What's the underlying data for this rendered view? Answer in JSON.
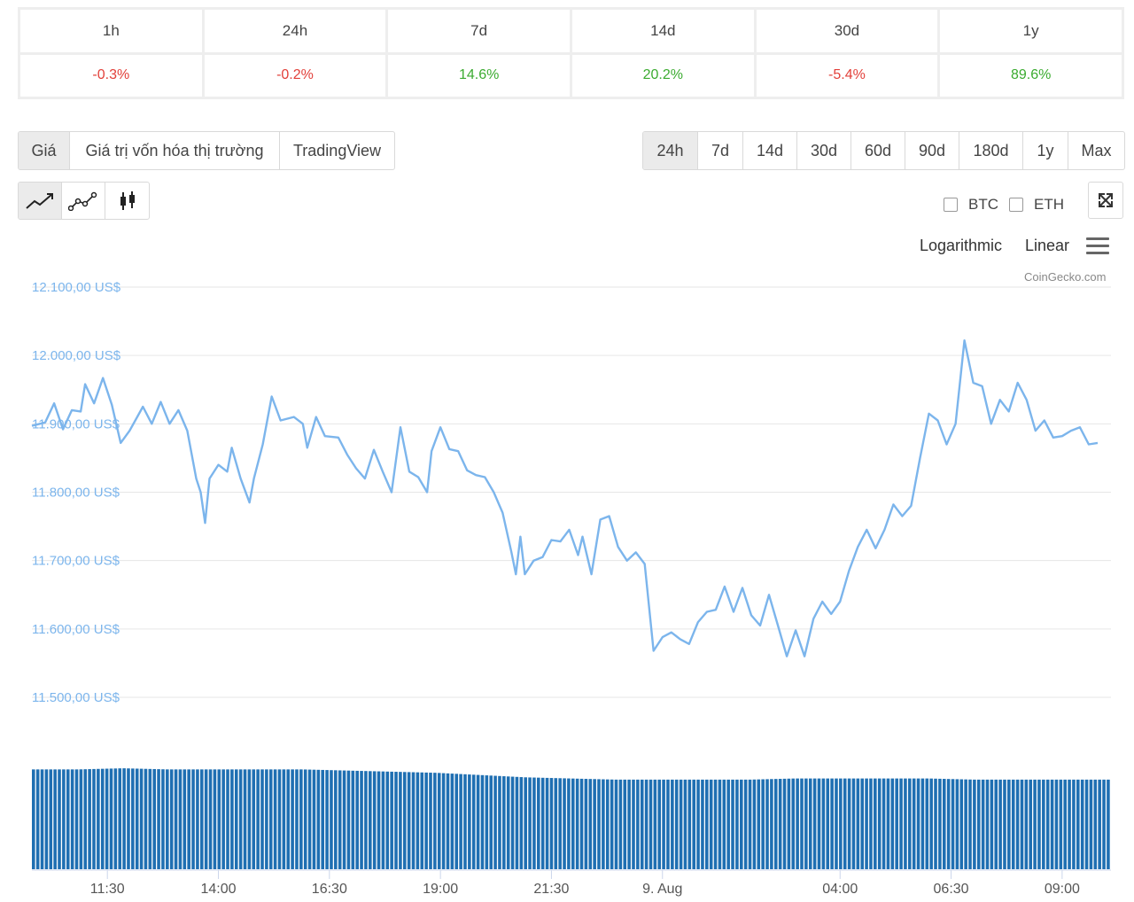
{
  "performance": {
    "periods": [
      "1h",
      "24h",
      "7d",
      "14d",
      "30d",
      "1y"
    ],
    "changes": [
      "-0.3%",
      "-0.2%",
      "14.6%",
      "20.2%",
      "-5.4%",
      "89.6%"
    ],
    "directions": [
      "neg",
      "neg",
      "pos",
      "pos",
      "neg",
      "pos"
    ]
  },
  "view_tabs": [
    "Giá",
    "Giá trị vốn hóa thị trường",
    "TradingView"
  ],
  "range_tabs": [
    "24h",
    "7d",
    "14d",
    "30d",
    "60d",
    "90d",
    "180d",
    "1y",
    "Max"
  ],
  "chart_type_icons": [
    "line-chart-icon",
    "scatter-line-icon",
    "candlestick-icon"
  ],
  "compare": {
    "btc": "BTC",
    "eth": "ETH"
  },
  "scale_options": {
    "log": "Logarithmic",
    "linear": "Linear"
  },
  "credits": "CoinGecko.com",
  "colors": {
    "line": "#7cb5ec",
    "volume": "#1f6fb2",
    "negative": "#e2403a",
    "positive": "#3bab30"
  },
  "chart_data": {
    "type": "line",
    "title": "",
    "ylabel": "",
    "xlabel": "",
    "ylim": [
      11500,
      12100
    ],
    "y_ticks": [
      "11.500,00 US$",
      "11.600,00 US$",
      "11.700,00 US$",
      "11.800,00 US$",
      "11.900,00 US$",
      "12.000,00 US$",
      "12.100,00 US$"
    ],
    "y_tick_values": [
      11500,
      11600,
      11700,
      11800,
      11900,
      12000,
      12100
    ],
    "x_ticks": [
      "11:30",
      "14:00",
      "16:30",
      "19:00",
      "21:30",
      "9. Aug",
      "04:00",
      "06:30",
      "09:00"
    ],
    "x_tick_hours": [
      11.5,
      14,
      16.5,
      19,
      21.5,
      24,
      28,
      30.5,
      33
    ],
    "x_range_hours": [
      9.8,
      34.1
    ],
    "series": [
      {
        "points": [
          [
            9.8,
            11897
          ],
          [
            10.1,
            11902
          ],
          [
            10.3,
            11930
          ],
          [
            10.5,
            11892
          ],
          [
            10.7,
            11920
          ],
          [
            10.9,
            11918
          ],
          [
            11.0,
            11958
          ],
          [
            11.2,
            11930
          ],
          [
            11.4,
            11967
          ],
          [
            11.6,
            11928
          ],
          [
            11.8,
            11872
          ],
          [
            12.0,
            11890
          ],
          [
            12.3,
            11925
          ],
          [
            12.5,
            11900
          ],
          [
            12.7,
            11932
          ],
          [
            12.9,
            11900
          ],
          [
            13.1,
            11920
          ],
          [
            13.3,
            11890
          ],
          [
            13.5,
            11820
          ],
          [
            13.6,
            11800
          ],
          [
            13.7,
            11755
          ],
          [
            13.8,
            11820
          ],
          [
            14.0,
            11840
          ],
          [
            14.2,
            11830
          ],
          [
            14.3,
            11865
          ],
          [
            14.5,
            11820
          ],
          [
            14.7,
            11785
          ],
          [
            14.8,
            11820
          ],
          [
            15.0,
            11870
          ],
          [
            15.2,
            11940
          ],
          [
            15.4,
            11905
          ],
          [
            15.7,
            11910
          ],
          [
            15.9,
            11900
          ],
          [
            16.0,
            11865
          ],
          [
            16.2,
            11910
          ],
          [
            16.4,
            11882
          ],
          [
            16.7,
            11880
          ],
          [
            16.9,
            11855
          ],
          [
            17.1,
            11835
          ],
          [
            17.3,
            11820
          ],
          [
            17.5,
            11862
          ],
          [
            17.7,
            11830
          ],
          [
            17.9,
            11800
          ],
          [
            18.1,
            11895
          ],
          [
            18.3,
            11830
          ],
          [
            18.5,
            11822
          ],
          [
            18.7,
            11800
          ],
          [
            18.8,
            11860
          ],
          [
            19.0,
            11895
          ],
          [
            19.2,
            11863
          ],
          [
            19.4,
            11860
          ],
          [
            19.6,
            11832
          ],
          [
            19.8,
            11825
          ],
          [
            20.0,
            11822
          ],
          [
            20.2,
            11800
          ],
          [
            20.4,
            11770
          ],
          [
            20.6,
            11712
          ],
          [
            20.7,
            11680
          ],
          [
            20.8,
            11735
          ],
          [
            20.9,
            11680
          ],
          [
            21.1,
            11700
          ],
          [
            21.3,
            11705
          ],
          [
            21.5,
            11730
          ],
          [
            21.7,
            11728
          ],
          [
            21.9,
            11745
          ],
          [
            22.1,
            11708
          ],
          [
            22.2,
            11735
          ],
          [
            22.4,
            11680
          ],
          [
            22.6,
            11760
          ],
          [
            22.8,
            11765
          ],
          [
            23.0,
            11720
          ],
          [
            23.2,
            11700
          ],
          [
            23.4,
            11712
          ],
          [
            23.6,
            11695
          ],
          [
            23.8,
            11568
          ],
          [
            24.0,
            11588
          ],
          [
            24.2,
            11595
          ],
          [
            24.4,
            11585
          ],
          [
            24.6,
            11578
          ],
          [
            24.8,
            11610
          ],
          [
            25.0,
            11625
          ],
          [
            25.2,
            11628
          ],
          [
            25.4,
            11662
          ],
          [
            25.6,
            11625
          ],
          [
            25.8,
            11660
          ],
          [
            26.0,
            11620
          ],
          [
            26.2,
            11605
          ],
          [
            26.4,
            11650
          ],
          [
            26.6,
            11605
          ],
          [
            26.8,
            11560
          ],
          [
            27.0,
            11598
          ],
          [
            27.2,
            11560
          ],
          [
            27.4,
            11615
          ],
          [
            27.6,
            11640
          ],
          [
            27.8,
            11622
          ],
          [
            28.0,
            11640
          ],
          [
            28.2,
            11685
          ],
          [
            28.4,
            11720
          ],
          [
            28.6,
            11745
          ],
          [
            28.8,
            11718
          ],
          [
            29.0,
            11745
          ],
          [
            29.2,
            11782
          ],
          [
            29.4,
            11765
          ],
          [
            29.6,
            11780
          ],
          [
            29.8,
            11850
          ],
          [
            30.0,
            11915
          ],
          [
            30.2,
            11905
          ],
          [
            30.4,
            11870
          ],
          [
            30.6,
            11900
          ],
          [
            30.8,
            12022
          ],
          [
            31.0,
            11960
          ],
          [
            31.2,
            11955
          ],
          [
            31.4,
            11900
          ],
          [
            31.6,
            11935
          ],
          [
            31.8,
            11918
          ],
          [
            32.0,
            11960
          ],
          [
            32.2,
            11935
          ],
          [
            32.4,
            11890
          ],
          [
            32.6,
            11905
          ],
          [
            32.8,
            11880
          ],
          [
            33.0,
            11882
          ],
          [
            33.2,
            11890
          ],
          [
            33.4,
            11895
          ],
          [
            33.6,
            11870
          ],
          [
            33.8,
            11872
          ]
        ]
      },
      {
        "name": "",
        "type": "bar",
        "relative_heights": [
          0.88,
          0.88,
          0.89,
          0.88,
          0.88,
          0.88,
          0.88,
          0.87,
          0.86,
          0.85,
          0.83,
          0.81,
          0.8,
          0.79,
          0.79,
          0.79,
          0.79,
          0.8,
          0.8,
          0.8,
          0.8,
          0.79,
          0.79,
          0.79,
          0.79
        ]
      }
    ]
  }
}
